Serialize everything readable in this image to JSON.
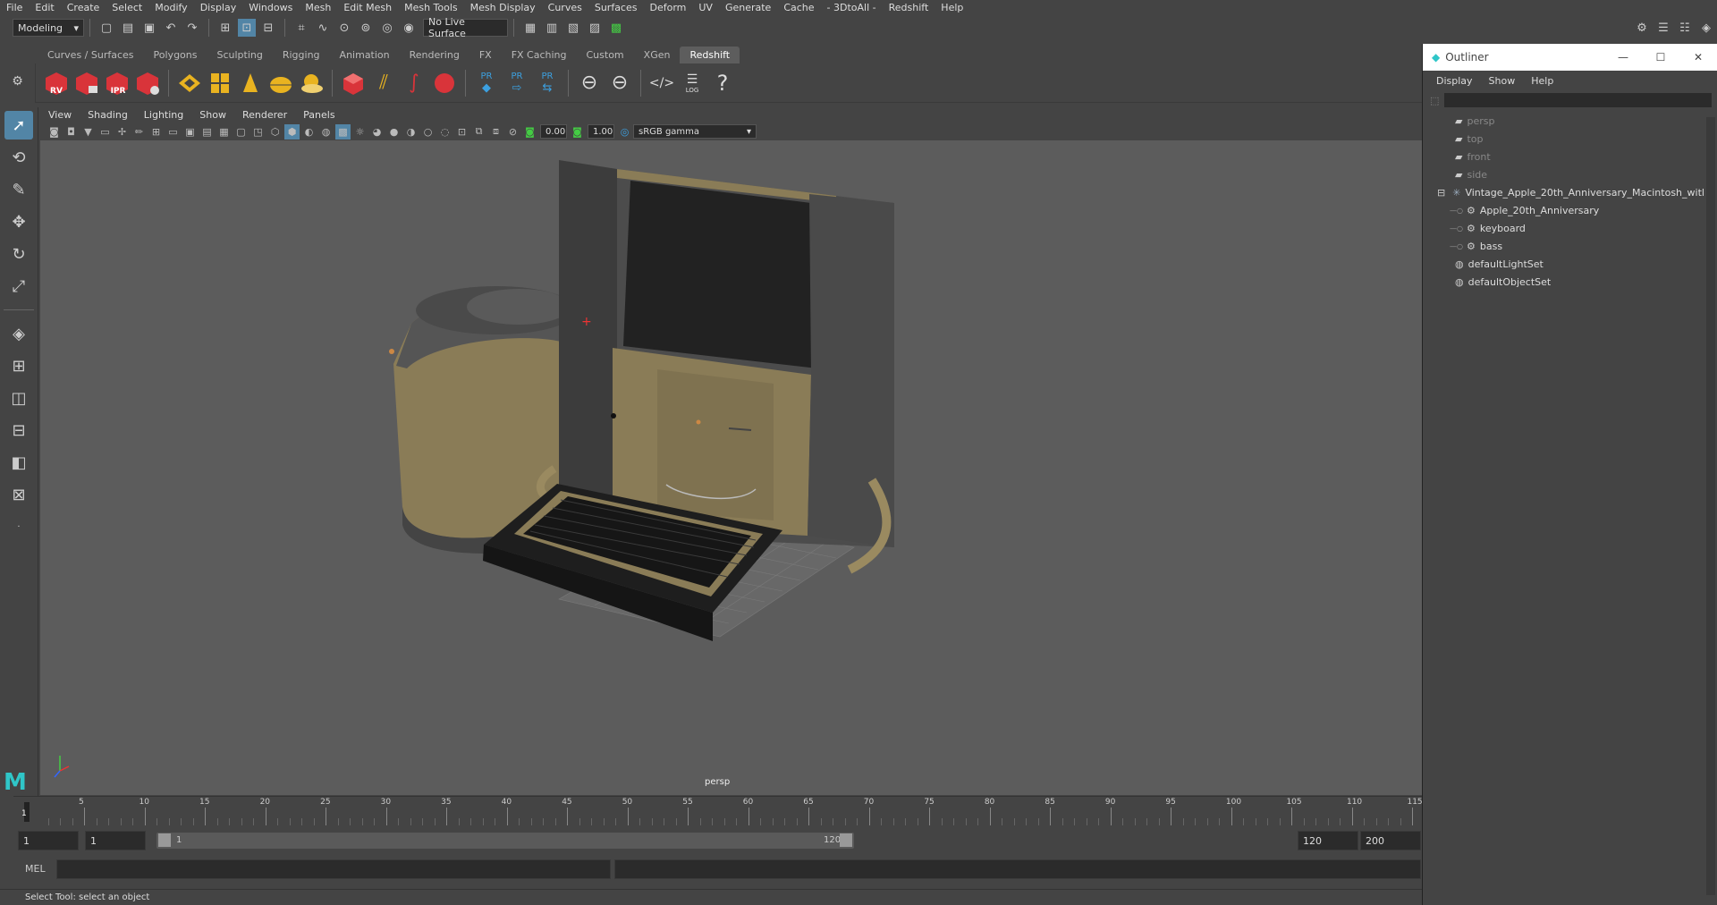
{
  "menu": [
    "File",
    "Edit",
    "Create",
    "Select",
    "Modify",
    "Display",
    "Windows",
    "Mesh",
    "Edit Mesh",
    "Mesh Tools",
    "Mesh Display",
    "Curves",
    "Surfaces",
    "Deform",
    "UV",
    "Generate",
    "Cache",
    "- 3DtoAll -",
    "Redshift",
    "Help"
  ],
  "status": {
    "workspace": "Modeling",
    "live_surface": "No Live Surface"
  },
  "shelf_tabs": [
    "Curves / Surfaces",
    "Polygons",
    "Sculpting",
    "Rigging",
    "Animation",
    "Rendering",
    "FX",
    "FX Caching",
    "Custom",
    "XGen",
    "Redshift"
  ],
  "active_shelf_tab": "Redshift",
  "shelf_labels": {
    "rv": "RV",
    "ipr": "IPR",
    "pr1": "PR",
    "pr2": "PR",
    "pr3": "PR",
    "log": "LOG"
  },
  "viewport_menu": [
    "View",
    "Shading",
    "Lighting",
    "Show",
    "Renderer",
    "Panels"
  ],
  "viewport_toolbar": {
    "exposure": "0.00",
    "gamma": "1.00",
    "colorspace": "sRGB gamma"
  },
  "viewport": {
    "camera_label": "persp"
  },
  "timeline": {
    "ticks": [
      "1",
      "5",
      "10",
      "15",
      "20",
      "25",
      "30",
      "35",
      "40",
      "45",
      "50",
      "55",
      "60",
      "65",
      "70",
      "75",
      "80",
      "85",
      "90",
      "95",
      "100",
      "105",
      "110",
      "115"
    ],
    "current_frame": "1"
  },
  "range": {
    "start": "1",
    "current": "1",
    "slider_start": "1",
    "slider_end": "120",
    "end": "120",
    "anim_end": "200"
  },
  "command": {
    "label": "MEL"
  },
  "help_line": "Select Tool: select an object",
  "outliner": {
    "title": "Outliner",
    "menu": [
      "Display",
      "Show",
      "Help"
    ],
    "items": [
      {
        "label": "persp",
        "dim": true
      },
      {
        "label": "top",
        "dim": true
      },
      {
        "label": "front",
        "dim": true
      },
      {
        "label": "side",
        "dim": true
      },
      {
        "label": "Vintage_Apple_20th_Anniversary_Macintosh_witl",
        "dim": false
      },
      {
        "label": "Apple_20th_Anniversary",
        "dim": false
      },
      {
        "label": "keyboard",
        "dim": false
      },
      {
        "label": "bass",
        "dim": false
      },
      {
        "label": "defaultLightSet",
        "dim": false
      },
      {
        "label": "defaultObjectSet",
        "dim": false
      }
    ]
  }
}
